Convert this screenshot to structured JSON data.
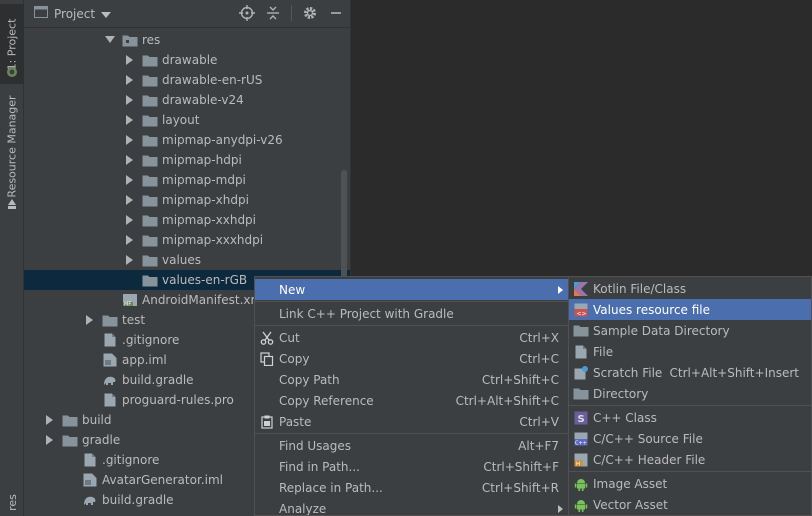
{
  "sidebar": {
    "project_tab": "1: Project",
    "resource_tab": "Resource Manager",
    "bottom_tab": "res"
  },
  "panel": {
    "title": "Project",
    "tools": [
      "locate-icon",
      "collapse-icon",
      "gear-icon",
      "minimize-icon"
    ]
  },
  "tree": [
    {
      "label": "res",
      "depth": 3,
      "arrow": "open",
      "icon": "res-folder"
    },
    {
      "label": "drawable",
      "depth": 4,
      "arrow": "closed",
      "icon": "folder"
    },
    {
      "label": "drawable-en-rUS",
      "depth": 4,
      "arrow": "closed",
      "icon": "folder"
    },
    {
      "label": "drawable-v24",
      "depth": 4,
      "arrow": "closed",
      "icon": "folder"
    },
    {
      "label": "layout",
      "depth": 4,
      "arrow": "closed",
      "icon": "folder"
    },
    {
      "label": "mipmap-anydpi-v26",
      "depth": 4,
      "arrow": "closed",
      "icon": "folder"
    },
    {
      "label": "mipmap-hdpi",
      "depth": 4,
      "arrow": "closed",
      "icon": "folder"
    },
    {
      "label": "mipmap-mdpi",
      "depth": 4,
      "arrow": "closed",
      "icon": "folder"
    },
    {
      "label": "mipmap-xhdpi",
      "depth": 4,
      "arrow": "closed",
      "icon": "folder"
    },
    {
      "label": "mipmap-xxhdpi",
      "depth": 4,
      "arrow": "closed",
      "icon": "folder"
    },
    {
      "label": "mipmap-xxxhdpi",
      "depth": 4,
      "arrow": "closed",
      "icon": "folder"
    },
    {
      "label": "values",
      "depth": 4,
      "arrow": "closed",
      "icon": "folder"
    },
    {
      "label": "values-en-rGB",
      "depth": 4,
      "arrow": "none",
      "icon": "folder",
      "selected": true
    },
    {
      "label": "AndroidManifest.xml",
      "depth": 3,
      "arrow": "none",
      "icon": "manifest"
    },
    {
      "label": "test",
      "depth": 2,
      "arrow": "closed",
      "icon": "folder"
    },
    {
      "label": ".gitignore",
      "depth": 2,
      "arrow": "none",
      "icon": "file"
    },
    {
      "label": "app.iml",
      "depth": 2,
      "arrow": "none",
      "icon": "iml"
    },
    {
      "label": "build.gradle",
      "depth": 2,
      "arrow": "none",
      "icon": "gradle"
    },
    {
      "label": "proguard-rules.pro",
      "depth": 2,
      "arrow": "none",
      "icon": "file"
    },
    {
      "label": "build",
      "depth": 0,
      "arrow": "closed",
      "icon": "folder"
    },
    {
      "label": "gradle",
      "depth": 0,
      "arrow": "closed",
      "icon": "folder"
    },
    {
      "label": ".gitignore",
      "depth": 1,
      "arrow": "none",
      "icon": "file"
    },
    {
      "label": "AvatarGenerator.iml",
      "depth": 1,
      "arrow": "none",
      "icon": "iml"
    },
    {
      "label": "build.gradle",
      "depth": 1,
      "arrow": "none",
      "icon": "gradle"
    }
  ],
  "context_menu": [
    {
      "label": "New",
      "shortcut": "",
      "icon": "",
      "submenu": true,
      "highlighted": true
    },
    {
      "sep": true
    },
    {
      "label": "Link C++ Project with Gradle",
      "shortcut": "",
      "icon": ""
    },
    {
      "sep": true
    },
    {
      "label": "Cut",
      "shortcut": "Ctrl+X",
      "icon": "scissors-icon"
    },
    {
      "label": "Copy",
      "shortcut": "Ctrl+C",
      "icon": "copy-icon"
    },
    {
      "label": "Copy Path",
      "shortcut": "Ctrl+Shift+C",
      "icon": ""
    },
    {
      "label": "Copy Reference",
      "shortcut": "Ctrl+Alt+Shift+C",
      "icon": ""
    },
    {
      "label": "Paste",
      "shortcut": "Ctrl+V",
      "icon": "paste-icon"
    },
    {
      "sep": true
    },
    {
      "label": "Find Usages",
      "shortcut": "Alt+F7",
      "icon": ""
    },
    {
      "label": "Find in Path...",
      "shortcut": "Ctrl+Shift+F",
      "icon": ""
    },
    {
      "label": "Replace in Path...",
      "shortcut": "Ctrl+Shift+R",
      "icon": ""
    },
    {
      "label": "Analyze",
      "shortcut": "",
      "icon": "",
      "submenu": true
    }
  ],
  "new_submenu": [
    {
      "label": "Kotlin File/Class",
      "shortcut": "",
      "icon": "kotlin-icon"
    },
    {
      "label": "Values resource file",
      "shortcut": "",
      "icon": "values-resource-icon",
      "highlighted": true
    },
    {
      "label": "Sample Data Directory",
      "shortcut": "",
      "icon": "folder-icon"
    },
    {
      "label": "File",
      "shortcut": "",
      "icon": "file-icon"
    },
    {
      "label": "Scratch File",
      "shortcut": "Ctrl+Alt+Shift+Insert",
      "icon": "scratch-file-icon"
    },
    {
      "label": "Directory",
      "shortcut": "",
      "icon": "folder-icon"
    },
    {
      "sep": true
    },
    {
      "label": "C++ Class",
      "shortcut": "",
      "icon": "cpp-class-icon"
    },
    {
      "label": "C/C++ Source File",
      "shortcut": "",
      "icon": "cpp-source-icon"
    },
    {
      "label": "C/C++ Header File",
      "shortcut": "",
      "icon": "cpp-header-icon"
    },
    {
      "sep": true
    },
    {
      "label": "Image Asset",
      "shortcut": "",
      "icon": "android-icon"
    },
    {
      "label": "Vector Asset",
      "shortcut": "",
      "icon": "android-icon"
    }
  ]
}
